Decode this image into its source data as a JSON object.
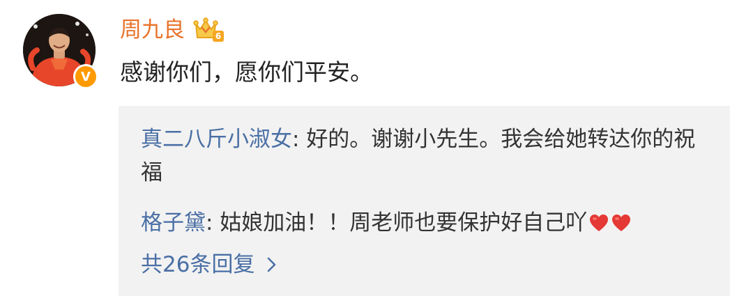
{
  "post": {
    "username": "周九良",
    "level_badge": "6",
    "verified_mark": "V",
    "text": "感谢你们，愿你们平安。"
  },
  "replies": {
    "items": [
      {
        "author": "真二八斤小淑女",
        "separator": ": ",
        "text": "好的。谢谢小先生。我会给她转达你的祝福"
      },
      {
        "author": "格子黛",
        "separator": ": ",
        "text": "姑娘加油！！周老师也要保护好自己吖",
        "emoji": [
          "heart-icon",
          "heart-icon"
        ]
      }
    ],
    "more_label": "共26条回复"
  },
  "colors": {
    "username": "#e8732b",
    "link": "#4a6fa5",
    "text": "#222222",
    "reply_bg": "#f2f2f2",
    "verified": "#ff9a00"
  }
}
